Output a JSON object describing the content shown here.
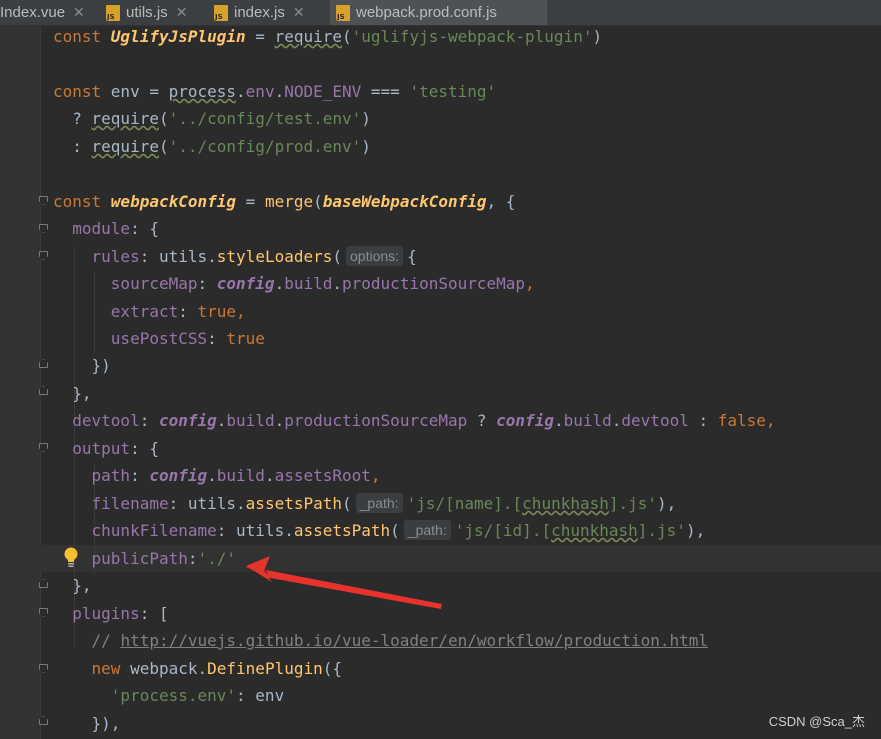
{
  "tabs": [
    {
      "label": "Index.vue",
      "icon": "vue-file-icon",
      "active": false
    },
    {
      "label": "utils.js",
      "icon": "js-file-icon",
      "active": false
    },
    {
      "label": "index.js",
      "icon": "js-file-icon",
      "active": false
    },
    {
      "label": "webpack.prod.conf.js",
      "icon": "js-file-icon",
      "active": true
    }
  ],
  "code": {
    "l1": {
      "kw": "const ",
      "name": "UglifyJsPlugin",
      "eq": " = ",
      "req": "require",
      "open": "(",
      "str": "'uglifyjs-webpack-plugin'",
      "close": ")"
    },
    "l3": {
      "kw": "const ",
      "name": "env = ",
      "process": "process",
      "dot": ".",
      "envp": "env",
      "dot2": ".",
      "node": "NODE_ENV",
      "op": " === ",
      "str": "'testing'"
    },
    "l4": {
      "q": "  ? ",
      "req": "require",
      "open": "(",
      "str": "'../config/test.env'",
      "close": ")"
    },
    "l5": {
      "q": "  : ",
      "req": "require",
      "open": "(",
      "str": "'../config/prod.env'",
      "close": ")"
    },
    "l7": {
      "kw": "const ",
      "name": "webpackConfig",
      "eq": " = ",
      "fn": "merge",
      "open": "(",
      "arg": "baseWebpackConfig",
      "rest": ", {"
    },
    "l8": {
      "ind": "  ",
      "prop": "module",
      "rest": ": {"
    },
    "l9": {
      "ind": "    ",
      "prop": "rules",
      "colon": ": ",
      "obj": "utils",
      "dot": ".",
      "fn": "styleLoaders",
      "open": "(",
      "hint": "options:",
      "rest": "{"
    },
    "l10": {
      "ind": "      ",
      "prop": "sourceMap",
      "colon": ": ",
      "cfg": "config",
      "dot": ".",
      "build": "build",
      "dot2": ".",
      "psm": "productionSourceMap",
      "comma": ","
    },
    "l11": {
      "ind": "      ",
      "prop": "extract",
      "colon": ": ",
      "val": "true",
      "comma": ","
    },
    "l12": {
      "ind": "      ",
      "prop": "usePostCSS",
      "colon": ": ",
      "val": "true"
    },
    "l13": {
      "ind": "    ",
      "rest": "})"
    },
    "l14": {
      "ind": "  ",
      "rest": "},"
    },
    "l15": {
      "ind": "  ",
      "prop": "devtool",
      "colon": ": ",
      "cfg": "config",
      "dot": ".",
      "build": "build",
      "dot2": ".",
      "psm": "productionSourceMap",
      "q": " ? ",
      "cfg2": "config",
      "dot3": ".",
      "build2": "build",
      "dot4": ".",
      "dt": "devtool",
      "c": " : ",
      "val": "false",
      "comma": ","
    },
    "l16": {
      "ind": "  ",
      "prop": "output",
      "rest": ": {"
    },
    "l17": {
      "ind": "    ",
      "prop": "path",
      "colon": ": ",
      "cfg": "config",
      "dot": ".",
      "build": "build",
      "dot2": ".",
      "ar": "assetsRoot",
      "comma": ","
    },
    "l18": {
      "ind": "    ",
      "prop": "filename",
      "colon": ": ",
      "obj": "utils",
      "dot": ".",
      "fn": "assetsPath",
      "open": "(",
      "hint": "_path:",
      "s1": "'js/[name].[",
      "s2": "chunkhash",
      "s3": "].js'",
      "close": "),"
    },
    "l19": {
      "ind": "    ",
      "prop": "chunkFilename",
      "colon": ": ",
      "obj": "utils",
      "dot": ".",
      "fn": "assetsPath",
      "open": "(",
      "hint": "_path:",
      "s1": "'js/[id].[",
      "s2": "chunkhash",
      "s3": "].js'",
      "close": "),"
    },
    "l20": {
      "ind": "    ",
      "prop": "publicPath",
      "colon": ":",
      "str": "'./'"
    },
    "l21": {
      "ind": "  ",
      "rest": "},"
    },
    "l22": {
      "ind": "  ",
      "prop": "plugins",
      "rest": ": ["
    },
    "l23": {
      "ind": "    ",
      "cmt": "// ",
      "url": "http://vuejs.github.io/vue-loader/en/workflow/production.html"
    },
    "l24": {
      "ind": "    ",
      "kw": "new ",
      "obj": "webpack",
      "dot": ".",
      "fn": "DefinePlugin",
      "rest": "({"
    },
    "l25": {
      "ind": "      ",
      "str": "'process.env'",
      "rest": ": env"
    },
    "l26": {
      "ind": "    ",
      "rest": "}),"
    }
  },
  "watermark": "CSDN @Sca_杰",
  "colors": {
    "keyword": "#cc7832",
    "string": "#6a8759",
    "property": "#9876aa",
    "function": "#ffc66d",
    "arrow": "#e8322c"
  }
}
